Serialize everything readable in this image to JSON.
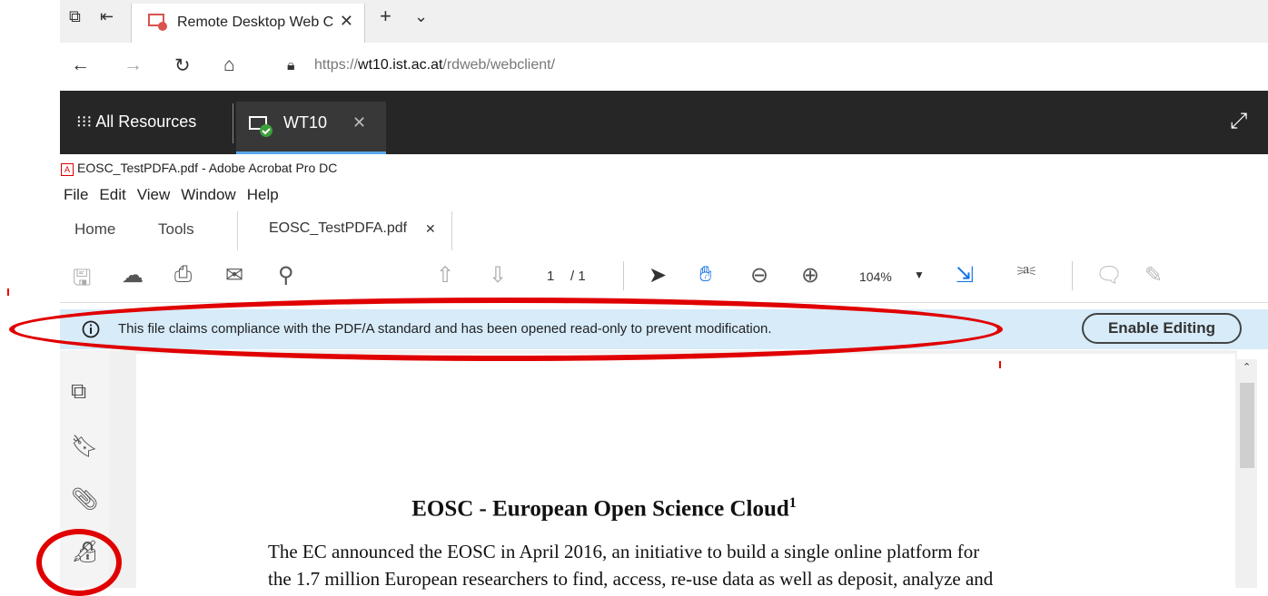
{
  "browser": {
    "tab_title": "Remote Desktop Web C",
    "url_prefix": "https://",
    "url_host": "wt10.ist.ac.at",
    "url_path": "/rdweb/webclient/"
  },
  "rdweb": {
    "all_resources": "All Resources",
    "session_tab": "WT10"
  },
  "acrobat": {
    "window_title": "EOSC_TestPDFA.pdf - Adobe Acrobat Pro DC",
    "menu": [
      "File",
      "Edit",
      "View",
      "Window",
      "Help"
    ],
    "tabs": {
      "home": "Home",
      "tools": "Tools",
      "document": "EOSC_TestPDFA.pdf"
    },
    "page_current": "1",
    "page_total": "/ 1",
    "zoom": "104%",
    "message": "This file claims compliance with the PDF/A standard and has been opened read-only to prevent modification.",
    "enable_editing": "Enable Editing"
  },
  "document": {
    "title": "EOSC - European Open Science Cloud",
    "footnote_mark": "1",
    "line1": "The EC announced the EOSC in April 2016, an initiative to build a single online platform for",
    "line2": "the 1.7 million European researchers to find, access, re-use data as well as deposit, analyze and"
  },
  "annotations": {
    "color": "#e00000"
  }
}
